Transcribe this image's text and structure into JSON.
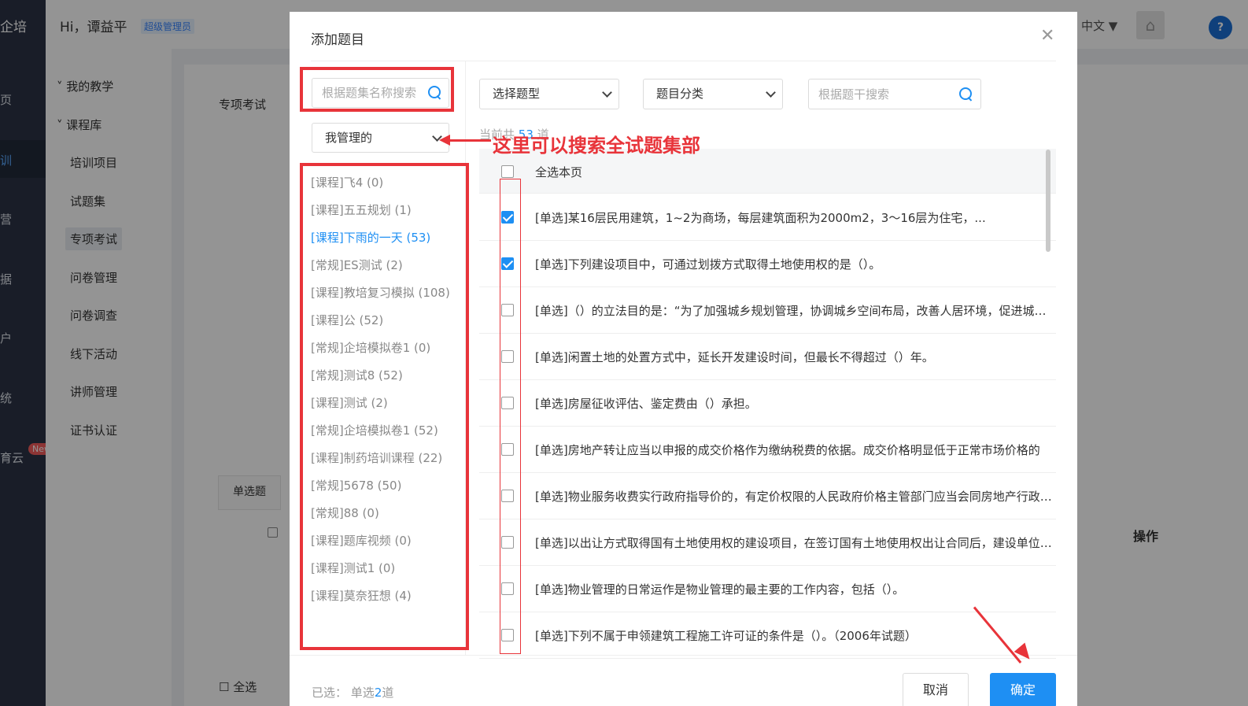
{
  "nav": {
    "brand": "企培",
    "items": [
      "页",
      "训",
      "营",
      "据",
      "户",
      "统",
      "育云"
    ],
    "new_badge": "New"
  },
  "topbar": {
    "greeting": "Hi，谭益平",
    "role_badge": "超级管理员",
    "language": "中文 ▼",
    "help": "?"
  },
  "subnav": {
    "groups": [
      "我的教学",
      "课程库"
    ],
    "items": [
      "培训项目",
      "试题集",
      "专项考试",
      "问卷管理",
      "问卷调查",
      "线下活动",
      "讲师管理",
      "证书认证"
    ],
    "selected": "专项考试"
  },
  "content": {
    "tab": "专项考试",
    "question_tab": "单选题",
    "operations_header": "操作",
    "select_all": "全选"
  },
  "modal": {
    "title": "添加题目",
    "set_search_placeholder": "根据题集名称搜索",
    "scope_select": "我管理的",
    "question_sets": [
      "[课程]飞4 (0)",
      "[课程]五五规划 (1)",
      "[课程]下雨的一天 (53)",
      "[常规]ES测试 (2)",
      "[课程]教培复习模拟 (108)",
      "[课程]公 (52)",
      "[常规]企培模拟卷1 (0)",
      "[常规]测试8 (52)",
      "[课程]测试 (2)",
      "[常规]企培模拟卷1 (52)",
      "[课程]制药培训课程 (22)",
      "[常规]5678 (50)",
      "[常规]88 (0)",
      "[课程]题库视频 (0)",
      "[课程]测试1 (0)",
      "[课程]莫奈狂想 (4)"
    ],
    "active_set_index": 2,
    "type_select": "选择题型",
    "category_select": "题目分类",
    "stem_search_placeholder": "根据题干搜索",
    "count_prefix": "当前共",
    "count_value": "53",
    "count_suffix": "道",
    "select_page_label": "全选本页",
    "questions": [
      {
        "text": "[单选]某16层民用建筑，1~2为商场，每层建筑面积为2000m2，3～16层为住宅，...",
        "checked": true
      },
      {
        "text": "[单选]下列建设项目中，可通过划拨方式取得土地使用权的是（）。",
        "checked": true
      },
      {
        "text": "[单选]（）的立法目的是：“为了加强城乡规划管理，协调城乡空间布局，改善人居环境，促进城乡经济社会全面协调可持续发展”",
        "checked": false
      },
      {
        "text": "[单选]闲置土地的处置方式中，延长开发建设时间，但最长不得超过（）年。",
        "checked": false
      },
      {
        "text": "[单选]房屋征收评估、鉴定费由（）承担。",
        "checked": false
      },
      {
        "text": "[单选]房地产转让应当以申报的成交价格作为缴纳税费的依据。成交价格明显低于正常市场价格的",
        "checked": false
      },
      {
        "text": "[单选]物业服务收费实行政府指导价的，有定价权限的人民政府价格主管部门应当会同房地产行政主管部门",
        "checked": false
      },
      {
        "text": "[单选]以出让方式取得国有土地使用权的建设项目，在签订国有土地使用权出让合同后，建设单位应当",
        "checked": false
      },
      {
        "text": "[单选]物业管理的日常运作是物业管理的最主要的工作内容，包括（）。",
        "checked": false
      },
      {
        "text": "[单选]下列不属于申领建筑工程施工许可证的条件是（）。（2006年试题）",
        "checked": false
      }
    ],
    "selected_prefix": "已选：",
    "selected_type": "单选",
    "selected_count": "2",
    "selected_suffix": "道",
    "cancel": "取消",
    "confirm": "确定"
  },
  "annotation": {
    "text": "这里可以搜索全试题集部",
    "color": "#e8343a"
  },
  "colors": {
    "accent": "#1e8ff3",
    "annotation_red": "#e8343a",
    "nav_bg": "#2b3346"
  }
}
